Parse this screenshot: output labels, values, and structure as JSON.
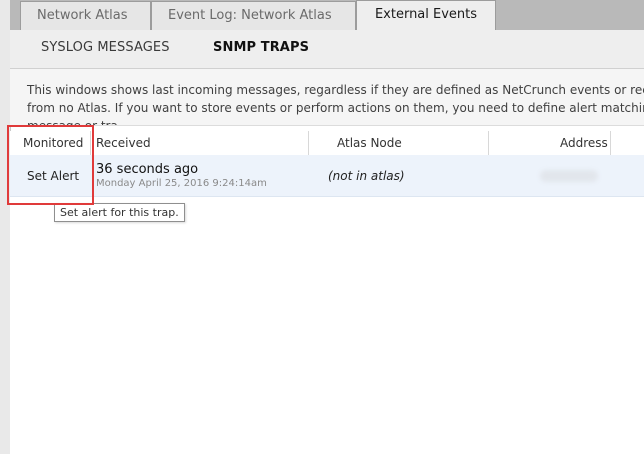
{
  "tabs": [
    {
      "label": "Network Atlas",
      "active": false
    },
    {
      "label": "Event Log: Network Atlas",
      "active": false
    },
    {
      "label": "External Events",
      "active": true
    }
  ],
  "subtabs": [
    {
      "label": "SYSLOG MESSAGES",
      "active": false
    },
    {
      "label": "SNMP TRAPS",
      "active": true
    }
  ],
  "description": "This windows shows last incoming messages, regardless if they are defined as NetCrunch events or received from no Atlas. If you want to store events or perform actions on them, you need to define alert matching given message or tra",
  "table": {
    "headers": {
      "monitored": "Monitored",
      "received": "Received",
      "atlas_node": "Atlas Node",
      "address": "Address"
    },
    "rows": [
      {
        "monitored": "Set Alert",
        "received": "36 seconds ago",
        "received_detail": "Monday April 25, 2016 9:24:14am",
        "atlas_node": "(not in atlas)"
      }
    ]
  },
  "tooltip": "Set alert for this trap.",
  "colors": {
    "highlight": "#e03a3a",
    "row_selected": "#edf3fb",
    "tabstrip": "#b9b9b9"
  }
}
